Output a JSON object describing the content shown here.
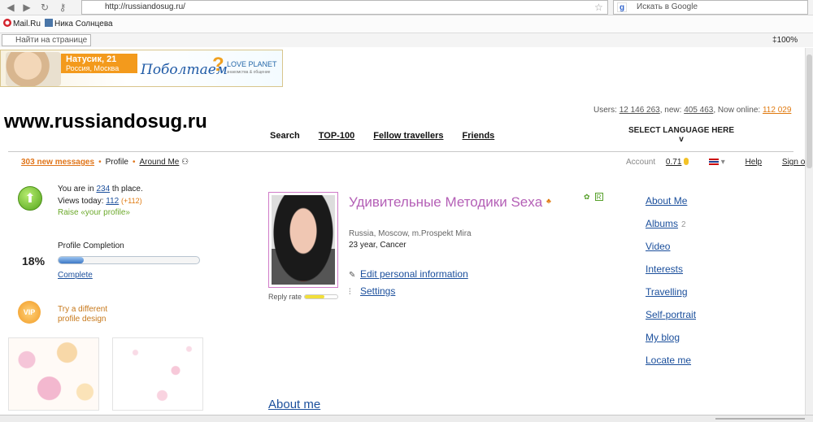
{
  "browser": {
    "url": "http://russiandosug.ru/",
    "search_placeholder": "Искать в Google",
    "bookmarks": [
      "Mail.Ru",
      "Ника Солнцева"
    ],
    "find_placeholder": "Найти на странице",
    "zoom": "100%",
    "icons": [
      "back-arrow-icon",
      "forward-arrow-icon",
      "reload-icon",
      "key-icon",
      "star-icon",
      "google-icon"
    ]
  },
  "banner": {
    "name": "Натусик, 21",
    "city": "Россия, Москва",
    "slogan": "Поболтаем",
    "question": "?",
    "logo": "LOVE PLANET",
    "logo_sub": "знакомства & общение"
  },
  "site_title": "www.russiandosug.ru",
  "nav": [
    "Search",
    "TOP-100",
    "Fellow travellers",
    "Friends"
  ],
  "stats": {
    "users_label": "Users:",
    "users": "12 146 263",
    "new_label": ", new:",
    "new": "405 463",
    "online_label": ", Now online:",
    "online": "112 029"
  },
  "language": {
    "label": "SELECT LANGUAGE  HERE",
    "arrow": "v"
  },
  "subnav": {
    "messages": "303 new messages",
    "profile": "Profile",
    "around": "Around Me"
  },
  "account": {
    "label": "Account",
    "balance": "0.71",
    "help": "Help",
    "signout": "Sign out"
  },
  "left": {
    "place_prefix": "You are in",
    "place": "234",
    "place_suffix": "th place.",
    "views_label": "Views today:",
    "views": "112",
    "views_plus": "(+112)",
    "raise": "Raise «your profile»",
    "completion_label": "Profile Completion",
    "completion_percent": "18%",
    "completion_value": 0.18,
    "complete_link": "Complete",
    "vip_badge": "VIP",
    "vip_text": "Try a different profile design"
  },
  "profile": {
    "name": "Удивительные Методики Sexa",
    "location": "Russia, Moscow, m.Prospekt Mira",
    "age": "23 year, Cancer",
    "edit": "Edit personal information",
    "settings": "Settings",
    "reply_rate_label": "Reply rate",
    "reply_rate": 0.6,
    "r_badge": "R",
    "about": "About me"
  },
  "right_menu": [
    {
      "label": "About Me",
      "count": ""
    },
    {
      "label": "Albums",
      "count": "2"
    },
    {
      "label": "Video",
      "count": ""
    },
    {
      "label": "Interests",
      "count": ""
    },
    {
      "label": "Travelling",
      "count": ""
    },
    {
      "label": "Self-portrait",
      "count": ""
    },
    {
      "label": "My blog",
      "count": ""
    },
    {
      "label": "Locate me",
      "count": ""
    }
  ],
  "colors": {
    "accent_orange": "#e07a10",
    "link_blue": "#1b4f9c",
    "name_purple": "#b45fb6",
    "green": "#56a02a"
  }
}
